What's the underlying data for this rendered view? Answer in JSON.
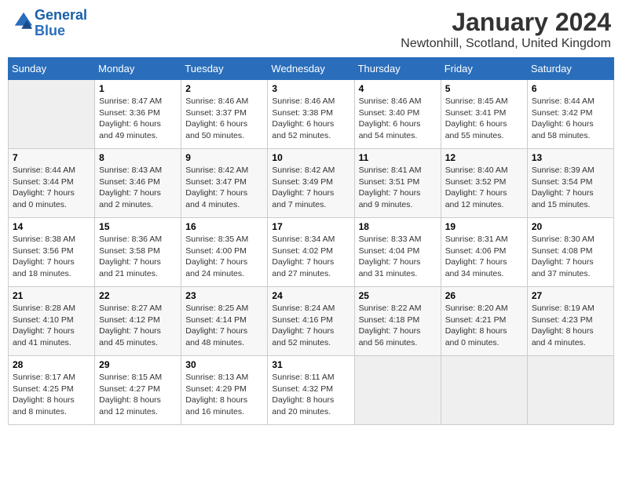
{
  "header": {
    "logo_line1": "General",
    "logo_line2": "Blue",
    "month": "January 2024",
    "location": "Newtonhill, Scotland, United Kingdom"
  },
  "days_of_week": [
    "Sunday",
    "Monday",
    "Tuesday",
    "Wednesday",
    "Thursday",
    "Friday",
    "Saturday"
  ],
  "weeks": [
    [
      {
        "day": "",
        "info": ""
      },
      {
        "day": "1",
        "info": "Sunrise: 8:47 AM\nSunset: 3:36 PM\nDaylight: 6 hours\nand 49 minutes."
      },
      {
        "day": "2",
        "info": "Sunrise: 8:46 AM\nSunset: 3:37 PM\nDaylight: 6 hours\nand 50 minutes."
      },
      {
        "day": "3",
        "info": "Sunrise: 8:46 AM\nSunset: 3:38 PM\nDaylight: 6 hours\nand 52 minutes."
      },
      {
        "day": "4",
        "info": "Sunrise: 8:46 AM\nSunset: 3:40 PM\nDaylight: 6 hours\nand 54 minutes."
      },
      {
        "day": "5",
        "info": "Sunrise: 8:45 AM\nSunset: 3:41 PM\nDaylight: 6 hours\nand 55 minutes."
      },
      {
        "day": "6",
        "info": "Sunrise: 8:44 AM\nSunset: 3:42 PM\nDaylight: 6 hours\nand 58 minutes."
      }
    ],
    [
      {
        "day": "7",
        "info": "Sunrise: 8:44 AM\nSunset: 3:44 PM\nDaylight: 7 hours\nand 0 minutes."
      },
      {
        "day": "8",
        "info": "Sunrise: 8:43 AM\nSunset: 3:46 PM\nDaylight: 7 hours\nand 2 minutes."
      },
      {
        "day": "9",
        "info": "Sunrise: 8:42 AM\nSunset: 3:47 PM\nDaylight: 7 hours\nand 4 minutes."
      },
      {
        "day": "10",
        "info": "Sunrise: 8:42 AM\nSunset: 3:49 PM\nDaylight: 7 hours\nand 7 minutes."
      },
      {
        "day": "11",
        "info": "Sunrise: 8:41 AM\nSunset: 3:51 PM\nDaylight: 7 hours\nand 9 minutes."
      },
      {
        "day": "12",
        "info": "Sunrise: 8:40 AM\nSunset: 3:52 PM\nDaylight: 7 hours\nand 12 minutes."
      },
      {
        "day": "13",
        "info": "Sunrise: 8:39 AM\nSunset: 3:54 PM\nDaylight: 7 hours\nand 15 minutes."
      }
    ],
    [
      {
        "day": "14",
        "info": "Sunrise: 8:38 AM\nSunset: 3:56 PM\nDaylight: 7 hours\nand 18 minutes."
      },
      {
        "day": "15",
        "info": "Sunrise: 8:36 AM\nSunset: 3:58 PM\nDaylight: 7 hours\nand 21 minutes."
      },
      {
        "day": "16",
        "info": "Sunrise: 8:35 AM\nSunset: 4:00 PM\nDaylight: 7 hours\nand 24 minutes."
      },
      {
        "day": "17",
        "info": "Sunrise: 8:34 AM\nSunset: 4:02 PM\nDaylight: 7 hours\nand 27 minutes."
      },
      {
        "day": "18",
        "info": "Sunrise: 8:33 AM\nSunset: 4:04 PM\nDaylight: 7 hours\nand 31 minutes."
      },
      {
        "day": "19",
        "info": "Sunrise: 8:31 AM\nSunset: 4:06 PM\nDaylight: 7 hours\nand 34 minutes."
      },
      {
        "day": "20",
        "info": "Sunrise: 8:30 AM\nSunset: 4:08 PM\nDaylight: 7 hours\nand 37 minutes."
      }
    ],
    [
      {
        "day": "21",
        "info": "Sunrise: 8:28 AM\nSunset: 4:10 PM\nDaylight: 7 hours\nand 41 minutes."
      },
      {
        "day": "22",
        "info": "Sunrise: 8:27 AM\nSunset: 4:12 PM\nDaylight: 7 hours\nand 45 minutes."
      },
      {
        "day": "23",
        "info": "Sunrise: 8:25 AM\nSunset: 4:14 PM\nDaylight: 7 hours\nand 48 minutes."
      },
      {
        "day": "24",
        "info": "Sunrise: 8:24 AM\nSunset: 4:16 PM\nDaylight: 7 hours\nand 52 minutes."
      },
      {
        "day": "25",
        "info": "Sunrise: 8:22 AM\nSunset: 4:18 PM\nDaylight: 7 hours\nand 56 minutes."
      },
      {
        "day": "26",
        "info": "Sunrise: 8:20 AM\nSunset: 4:21 PM\nDaylight: 8 hours\nand 0 minutes."
      },
      {
        "day": "27",
        "info": "Sunrise: 8:19 AM\nSunset: 4:23 PM\nDaylight: 8 hours\nand 4 minutes."
      }
    ],
    [
      {
        "day": "28",
        "info": "Sunrise: 8:17 AM\nSunset: 4:25 PM\nDaylight: 8 hours\nand 8 minutes."
      },
      {
        "day": "29",
        "info": "Sunrise: 8:15 AM\nSunset: 4:27 PM\nDaylight: 8 hours\nand 12 minutes."
      },
      {
        "day": "30",
        "info": "Sunrise: 8:13 AM\nSunset: 4:29 PM\nDaylight: 8 hours\nand 16 minutes."
      },
      {
        "day": "31",
        "info": "Sunrise: 8:11 AM\nSunset: 4:32 PM\nDaylight: 8 hours\nand 20 minutes."
      },
      {
        "day": "",
        "info": ""
      },
      {
        "day": "",
        "info": ""
      },
      {
        "day": "",
        "info": ""
      }
    ]
  ]
}
